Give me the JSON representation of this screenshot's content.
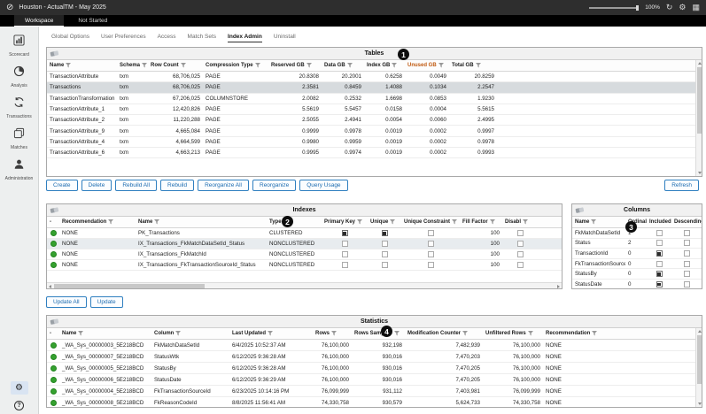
{
  "title_bar": {
    "title": "Houston - ActualTM - May 2025",
    "zoom": "100%"
  },
  "workspace_bar": {
    "tab": "Workspace",
    "status": "Not Started"
  },
  "sidebar": {
    "items": [
      "Scorecard",
      "Analysis",
      "Transactions",
      "Matches",
      "Administration"
    ]
  },
  "tabs": {
    "items": [
      "Global Options",
      "User Preferences",
      "Access",
      "Match Sets",
      "Index Admin",
      "Uninstall"
    ],
    "selected": "Index Admin"
  },
  "table_actions": [
    "Create",
    "Delete",
    "Rebuild All",
    "Rebuild",
    "Reorganize All",
    "Reorganize",
    "Query Usage"
  ],
  "refresh_action": "Refresh",
  "index_actions": [
    "Update All",
    "Update"
  ],
  "annotations": [
    "1",
    "2",
    "3",
    "4"
  ],
  "tables_panel": {
    "title": "Tables",
    "highlighted_header": "Unused GB",
    "selected_row_index": 1,
    "headers": [
      "Name",
      "Schema",
      "Row Count",
      "Compression Type",
      "Reserved GB",
      "Data GB",
      "Index GB",
      "Unused GB",
      "Total GB"
    ],
    "rows": [
      [
        "TransactionAttribute",
        "txm",
        "68,706,025",
        "PAGE",
        "20.8308",
        "20.2001",
        "0.6258",
        "0.0049",
        "20.8259"
      ],
      [
        "Transactions",
        "txm",
        "68,706,025",
        "PAGE",
        "2.3581",
        "0.8459",
        "1.4088",
        "0.1034",
        "2.2547"
      ],
      [
        "TransactionTransformation",
        "txm",
        "67,206,025",
        "COLUMNSTORE",
        "2.0082",
        "0.2532",
        "1.6698",
        "0.0853",
        "1.9230"
      ],
      [
        "TransactionAttribute_1",
        "txm",
        "12,420,826",
        "PAGE",
        "5.5619",
        "5.5457",
        "0.0158",
        "0.0004",
        "5.5615"
      ],
      [
        "TransactionAttribute_2",
        "txm",
        "11,220,288",
        "PAGE",
        "2.5055",
        "2.4941",
        "0.0054",
        "0.0060",
        "2.4995"
      ],
      [
        "TransactionAttribute_9",
        "txm",
        "4,665,084",
        "PAGE",
        "0.9999",
        "0.9978",
        "0.0019",
        "0.0002",
        "0.9997"
      ],
      [
        "TransactionAttribute_4",
        "txm",
        "4,664,599",
        "PAGE",
        "0.9980",
        "0.9959",
        "0.0019",
        "0.0002",
        "0.9978"
      ],
      [
        "TransactionAttribute_6",
        "txm",
        "4,663,213",
        "PAGE",
        "0.9995",
        "0.9974",
        "0.0019",
        "0.0002",
        "0.9993"
      ]
    ]
  },
  "indexes_panel": {
    "title": "Indexes",
    "selected_row_index": 1,
    "headers": [
      "-",
      "Recommendation",
      "Name",
      "Type",
      "Primary Key",
      "Unique",
      "Unique Constraint",
      "Fill Factor",
      "Disabl"
    ],
    "rows": [
      [
        true,
        "NONE",
        "PK_Transactions",
        "CLUSTERED",
        true,
        true,
        false,
        "100",
        false
      ],
      [
        true,
        "NONE",
        "IX_Transactions_FkMatchDataSetId_Status",
        "NONCLUSTERED",
        false,
        false,
        false,
        "100",
        false
      ],
      [
        true,
        "NONE",
        "IX_Transactions_FkMatchId",
        "NONCLUSTERED",
        false,
        false,
        false,
        "100",
        false
      ],
      [
        true,
        "NONE",
        "IX_Transactions_FkTransactionSourceId_Status",
        "NONCLUSTERED",
        false,
        false,
        false,
        "100",
        false
      ]
    ]
  },
  "columns_panel": {
    "title": "Columns",
    "headers": [
      "Name",
      "Ordinal",
      "Included",
      "Descending"
    ],
    "rows": [
      [
        "FkMatchDataSetId",
        "1",
        false,
        false
      ],
      [
        "Status",
        "2",
        false,
        false
      ],
      [
        "TransactionId",
        "0",
        true,
        false
      ],
      [
        "FkTransactionSourceId",
        "0",
        false,
        false
      ],
      [
        "StatusBy",
        "0",
        true,
        false
      ],
      [
        "StatusDate",
        "0",
        true,
        false
      ]
    ]
  },
  "statistics_panel": {
    "title": "Statistics",
    "headers": [
      "-",
      "Name",
      "Column",
      "Last Updated",
      "Rows",
      "Rows Sampled",
      "Modification Counter",
      "Unfiltered Rows",
      "Recommendation"
    ],
    "rows": [
      [
        true,
        "_WA_Sys_00000003_5E218BCD",
        "FkMatchDataSetId",
        "6/4/2025 10:52:37 AM",
        "76,100,000",
        "932,198",
        "7,482,939",
        "76,100,000",
        "NONE"
      ],
      [
        true,
        "_WA_Sys_00000007_5E218BCD",
        "StatusWtk",
        "6/12/2025 9:36:28 AM",
        "76,100,000",
        "930,016",
        "7,470,203",
        "76,100,000",
        "NONE"
      ],
      [
        true,
        "_WA_Sys_00000005_5E218BCD",
        "StatusBy",
        "6/12/2025 9:36:28 AM",
        "76,100,000",
        "930,016",
        "7,470,205",
        "76,100,000",
        "NONE"
      ],
      [
        true,
        "_WA_Sys_00000006_5E218BCD",
        "StatusDate",
        "6/12/2025 9:36:29 AM",
        "76,100,000",
        "930,016",
        "7,470,205",
        "76,100,000",
        "NONE"
      ],
      [
        true,
        "_WA_Sys_00000004_5E218BCD",
        "FkTransactionSourceId",
        "6/23/2025 10:14:16 PM",
        "76,099,999",
        "931,112",
        "7,403,981",
        "76,099,999",
        "NONE"
      ],
      [
        true,
        "_WA_Sys_00000008_5E218BCD",
        "FkReasonCodeId",
        "8/8/2025 11:56:41 AM",
        "74,330,758",
        "930,579",
        "5,624,733",
        "74,330,758",
        "NONE"
      ]
    ]
  }
}
